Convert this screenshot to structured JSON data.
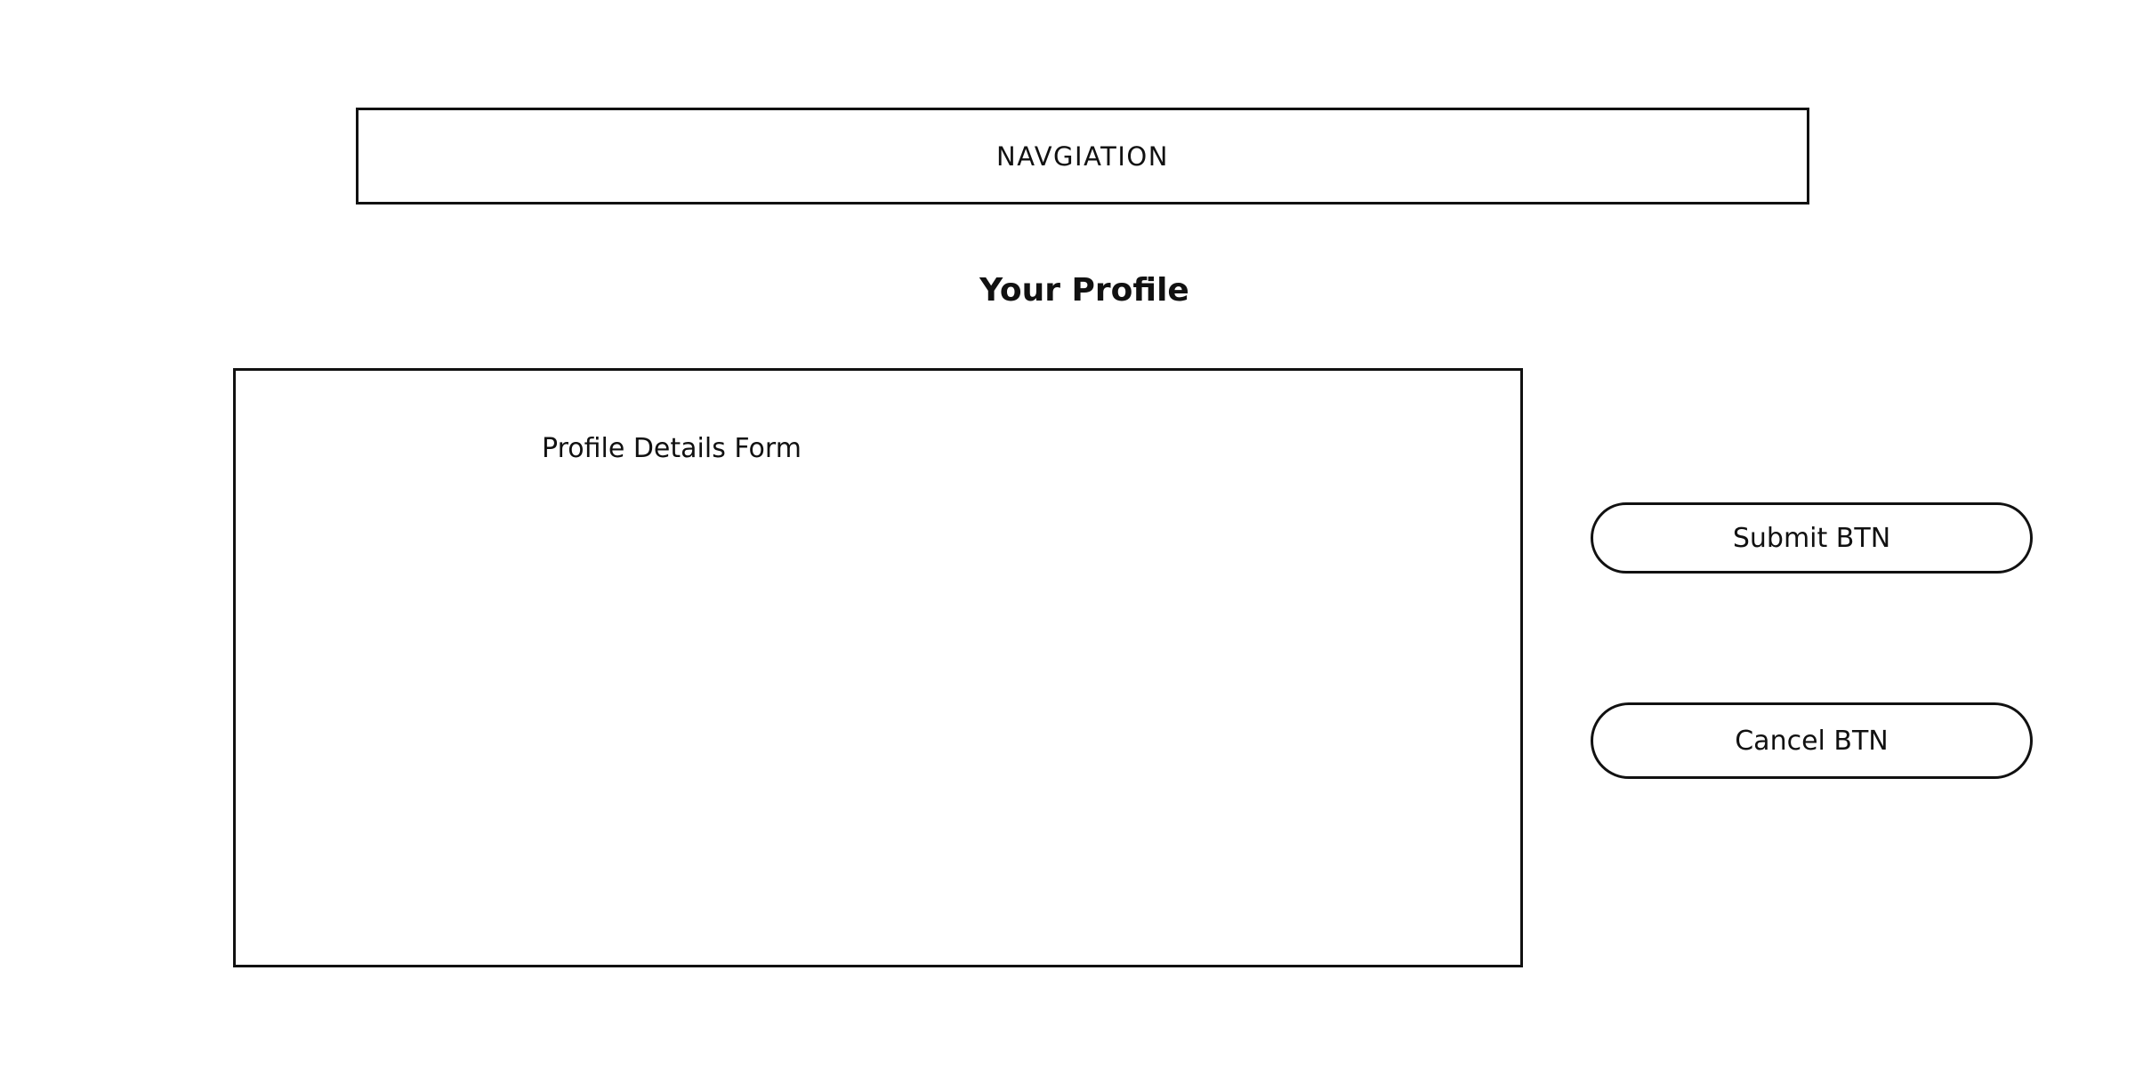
{
  "navigation": {
    "label": "NAVGIATION"
  },
  "page": {
    "title": "Your Profile"
  },
  "form": {
    "label": "Profile Details Form"
  },
  "actions": {
    "submit_label": "Submit BTN",
    "cancel_label": "Cancel BTN"
  },
  "colors": {
    "stroke": "#111111",
    "background": "#ffffff"
  }
}
